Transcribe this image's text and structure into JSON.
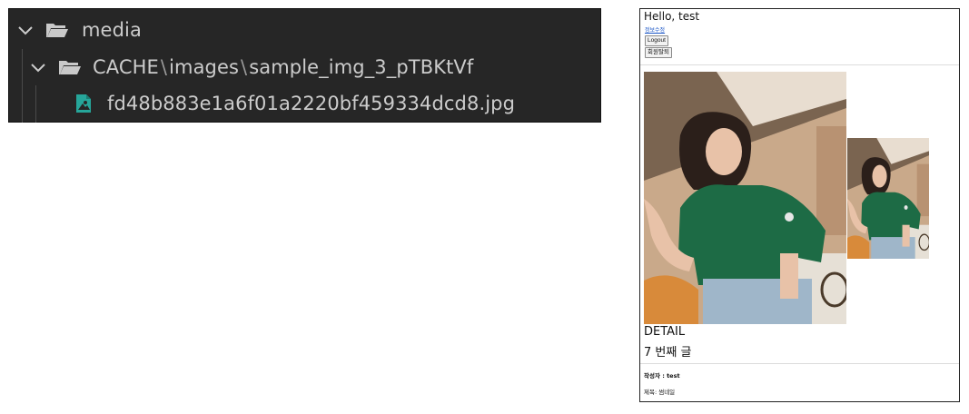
{
  "explorer": {
    "folder_root": "media",
    "path_parts": [
      "CACHE",
      "images",
      "sample_img_3_pTBKtVf"
    ],
    "path_separator": "\\",
    "file_name": "fd48b883e1a6f01a2220bf459334dcd8.jpg",
    "colors": {
      "background": "#262626",
      "text": "#cccccc",
      "image_icon": "#26a69a"
    }
  },
  "page": {
    "greeting": "Hello, test",
    "edit_profile_link": "정보수정",
    "logout_button": "Logout",
    "withdraw_button": "회원탈퇴",
    "heading_detail": "DETAIL",
    "post_number": "7 번째 글",
    "author_line": "작성자 : test",
    "title_line": "제목: 썸네일",
    "colors": {
      "link": "#1a55c6",
      "shirt": "#1d6b45",
      "border": "#222222"
    }
  }
}
